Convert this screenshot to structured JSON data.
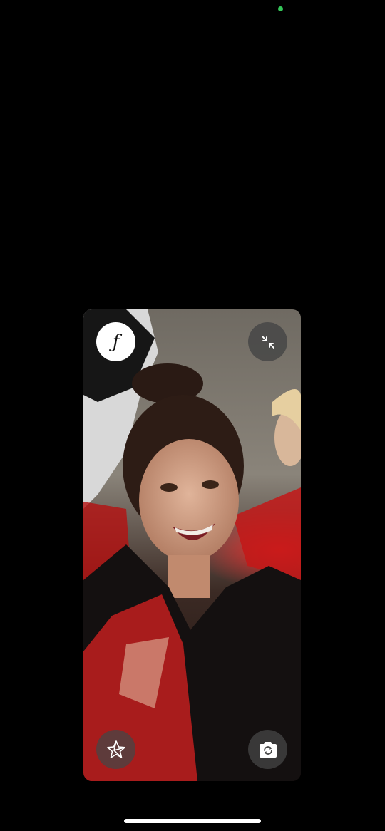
{
  "status": {
    "camera_indicator_color": "#34c759"
  },
  "video_tile": {
    "description_icons": {
      "effects": "effects-f-icon",
      "collapse": "collapse-arrows-icon",
      "star": "star-effects-icon",
      "flip": "camera-flip-icon"
    },
    "effects_glyph": "ƒ"
  },
  "colors": {
    "background": "#000000",
    "accent_green": "#34c759",
    "button_light": "#ffffff",
    "button_dark": "#464646"
  }
}
